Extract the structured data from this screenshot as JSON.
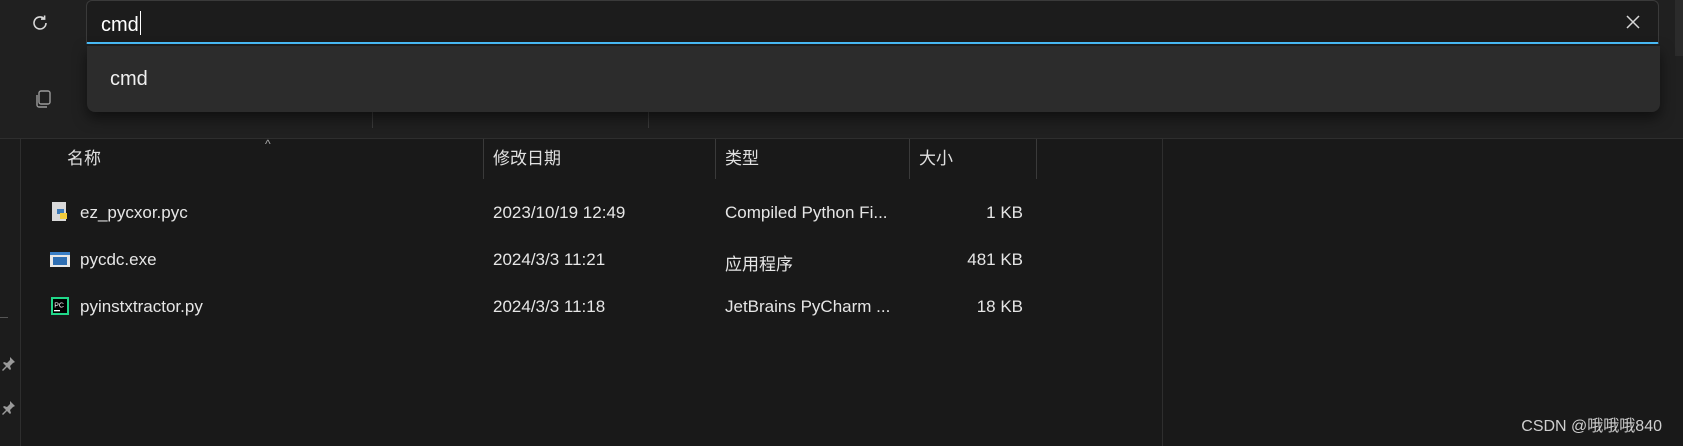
{
  "address_bar": {
    "value": "cmd"
  },
  "suggestions": [
    {
      "label": "cmd"
    }
  ],
  "columns": {
    "name": "名称",
    "modified": "修改日期",
    "type": "类型",
    "size": "大小"
  },
  "files": [
    {
      "name": "ez_pycxor.pyc",
      "modified": "2023/10/19 12:49",
      "type": "Compiled Python Fi...",
      "size": "1 KB",
      "icon": "python-compiled-icon"
    },
    {
      "name": "pycdc.exe",
      "modified": "2024/3/3 11:21",
      "type": "应用程序",
      "size": "481 KB",
      "icon": "exe-icon"
    },
    {
      "name": "pyinstxtractor.py",
      "modified": "2024/3/3 11:18",
      "type": "JetBrains PyCharm ...",
      "size": "18 KB",
      "icon": "pycharm-icon"
    }
  ],
  "watermark": "CSDN @哦哦哦840",
  "colors": {
    "accent": "#4cc2ff",
    "background": "#191919",
    "panel": "#202020"
  }
}
